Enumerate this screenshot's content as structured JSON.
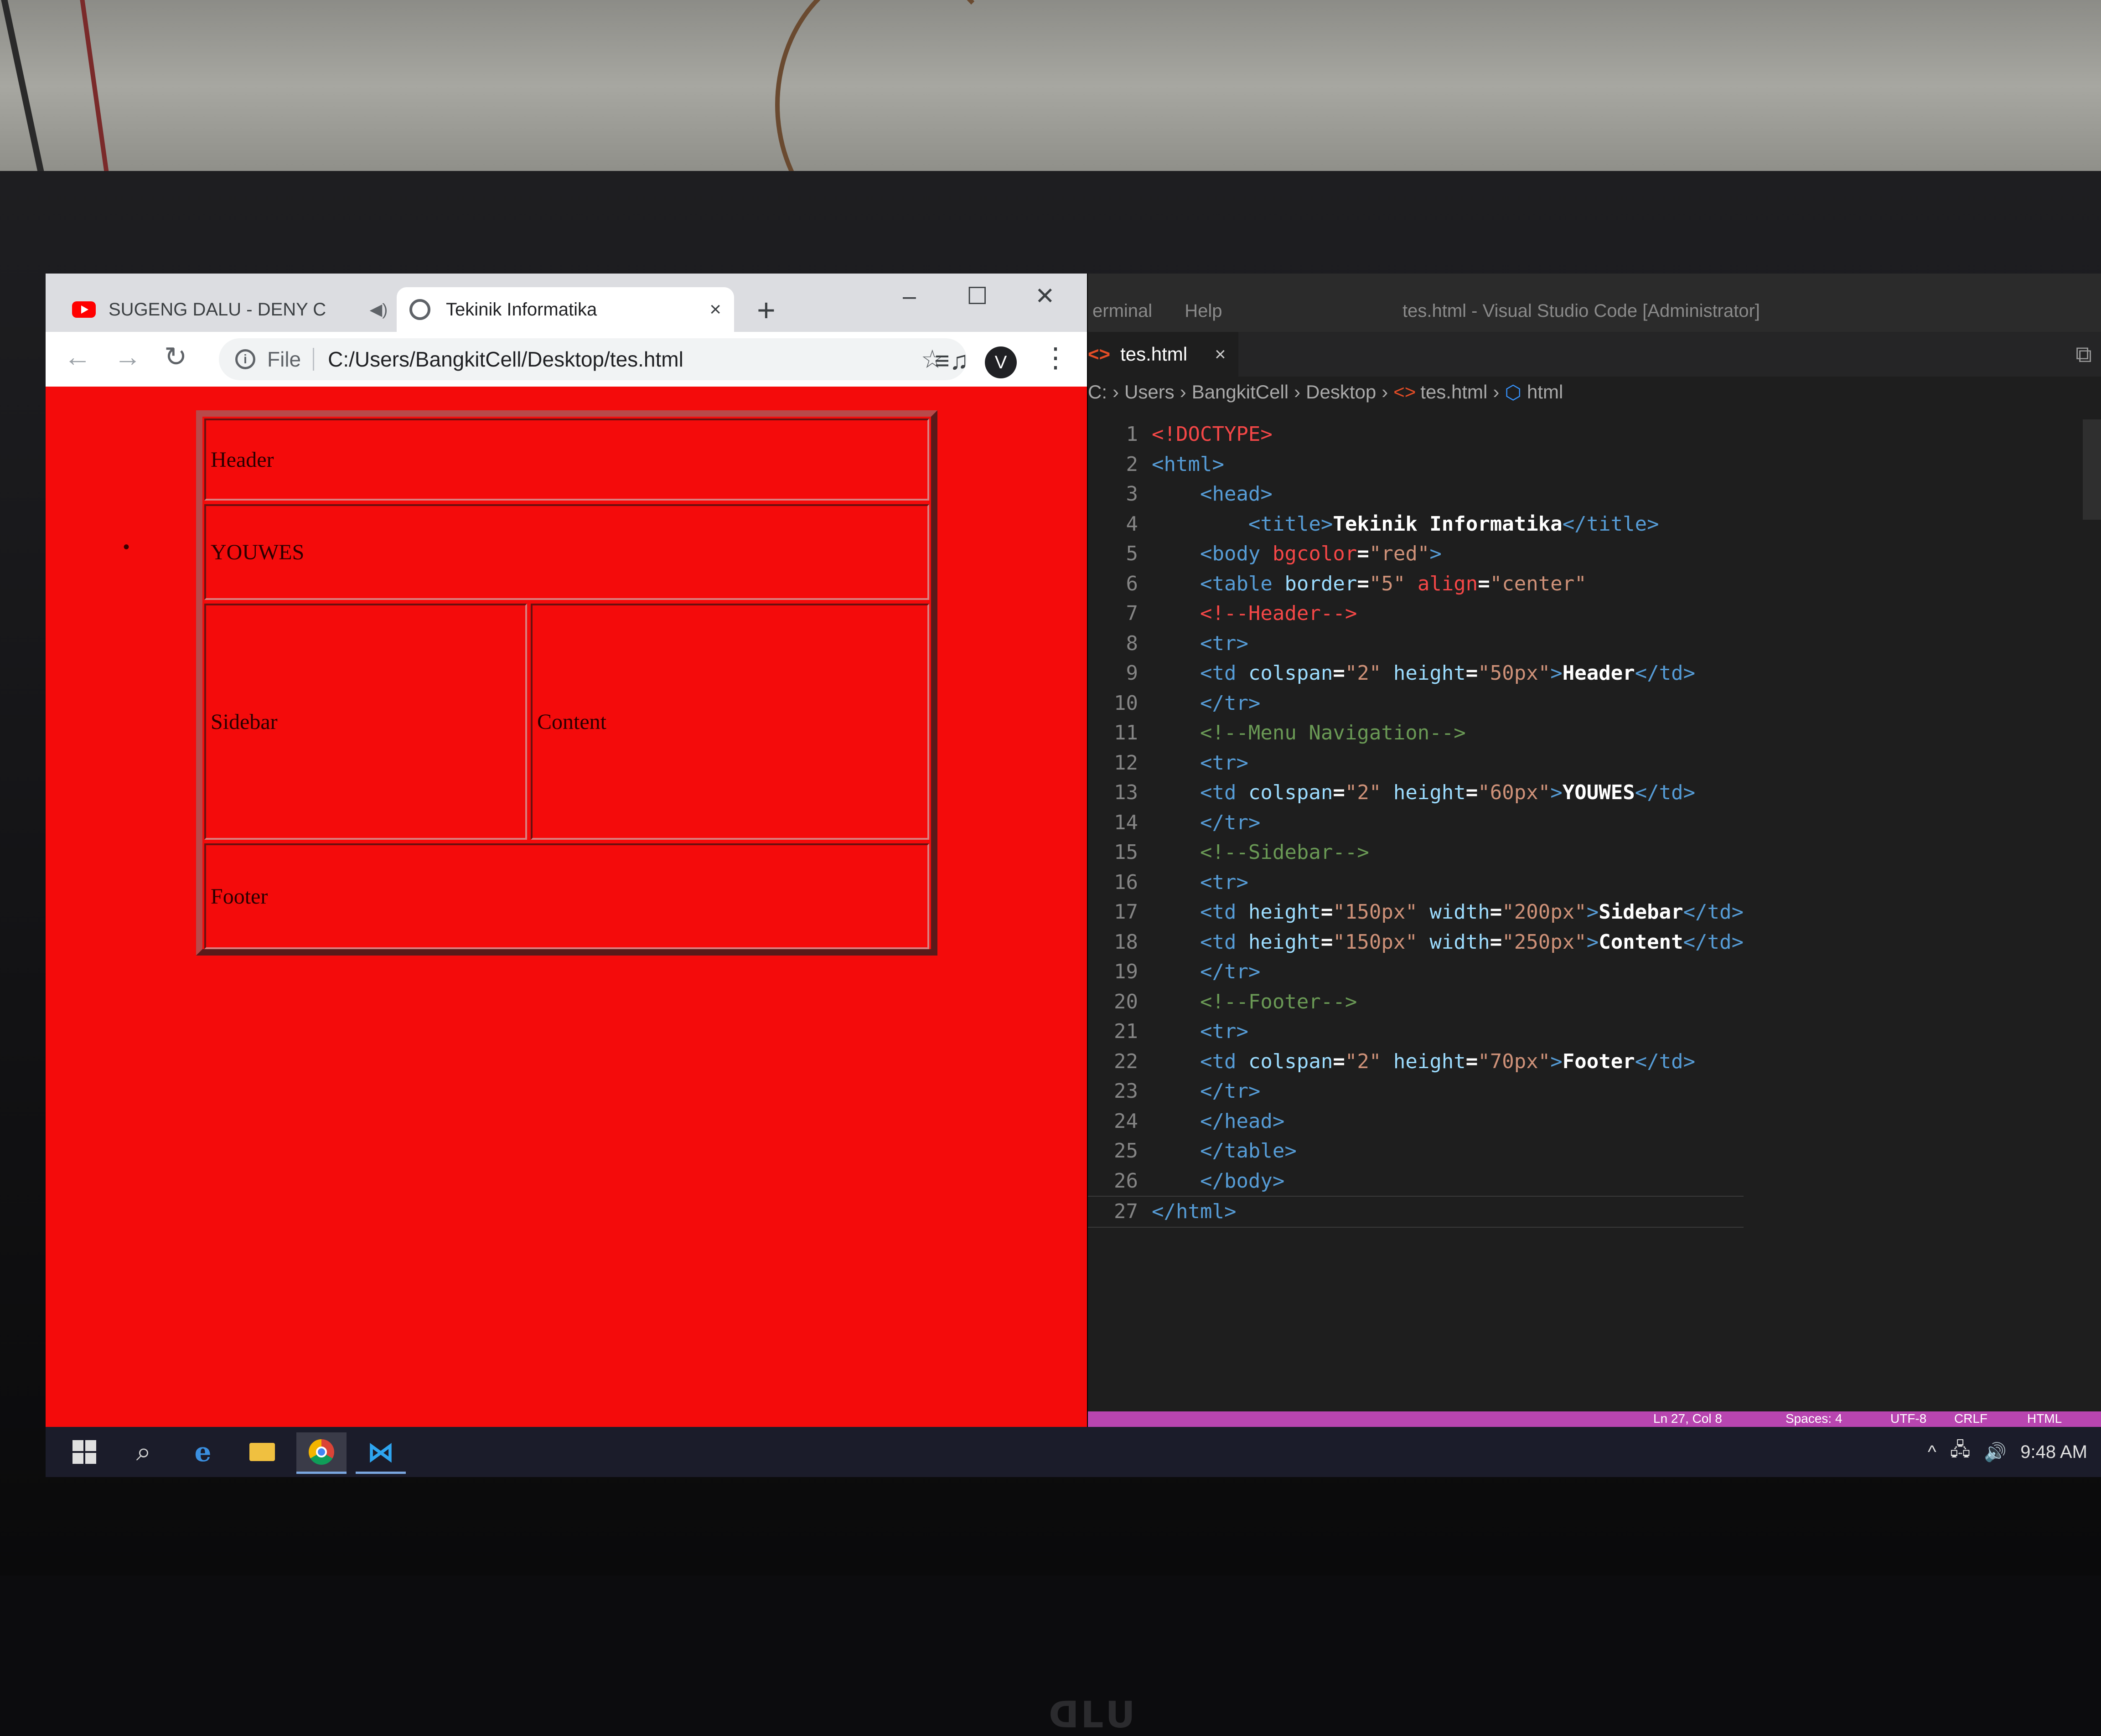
{
  "chrome": {
    "tabs": [
      {
        "title": "SUGENG DALU - DENY C",
        "icon": "youtube-icon",
        "muted_icon": "speaker-icon",
        "close": "×"
      },
      {
        "title": "Tekinik Informatika",
        "icon": "globe-icon",
        "close": "×"
      }
    ],
    "new_tab": "+",
    "window_controls": {
      "minimize": "–",
      "maximize": "☐",
      "close": "✕"
    },
    "nav": {
      "back": "←",
      "forward": "→",
      "reload": "↻"
    },
    "address": {
      "scheme_label": "File",
      "info_icon": "i",
      "url": "C:/Users/BangkitCell/Desktop/tes.html"
    },
    "star": "☆",
    "media": "≡♫",
    "profile_initial": "V",
    "menu": "⋮"
  },
  "page": {
    "bullet": "•",
    "cells": {
      "header": "Header",
      "nav": "YOUWES",
      "sidebar": "Sidebar",
      "content": "Content",
      "footer": "Footer"
    },
    "bgcolor": "#f40b0b"
  },
  "vscode": {
    "menu": [
      "erminal",
      "Help"
    ],
    "window_title": "tes.html - Visual Studio Code [Administrator]",
    "tab": {
      "icon": "<>",
      "name": "tes.html",
      "close": "×"
    },
    "breadcrumb": {
      "drive": "C:",
      "parts": [
        "Users",
        "BangkitCell",
        "Desktop",
        "tes.html",
        "html"
      ]
    },
    "status": {
      "position": "Ln 27, Col 8",
      "spaces": "Spaces: 4",
      "encoding": "UTF-8",
      "eol": "CRLF",
      "lang": "HTML"
    }
  },
  "code_lines": [
    [
      [
        "t-doc",
        "<!DOCTYPE>"
      ]
    ],
    [
      [
        "t-tag",
        "<html>"
      ]
    ],
    [
      [
        "",
        "    "
      ],
      [
        "t-tag",
        "<head>"
      ]
    ],
    [
      [
        "",
        "        "
      ],
      [
        "t-tag",
        "<title>"
      ],
      [
        "t-text",
        "Tekinik Informatika"
      ],
      [
        "t-tag",
        "</title>"
      ]
    ],
    [
      [
        "",
        "    "
      ],
      [
        "t-tag",
        "<body "
      ],
      [
        "t-red",
        "bgcolor"
      ],
      [
        "t-text",
        "="
      ],
      [
        "t-str",
        "\"red\""
      ],
      [
        "t-tag",
        ">"
      ]
    ],
    [
      [
        "",
        "    "
      ],
      [
        "t-tag",
        "<table "
      ],
      [
        "t-attr",
        "border"
      ],
      [
        "t-text",
        "="
      ],
      [
        "t-str",
        "\"5\" "
      ],
      [
        "t-red",
        "align"
      ],
      [
        "t-text",
        "="
      ],
      [
        "t-str",
        "\"center\""
      ]
    ],
    [
      [
        "",
        "    "
      ],
      [
        "t-red",
        "<!--Header-->"
      ]
    ],
    [
      [
        "",
        "    "
      ],
      [
        "t-tag",
        "<tr>"
      ]
    ],
    [
      [
        "",
        "    "
      ],
      [
        "t-tag",
        "<td "
      ],
      [
        "t-attr",
        "colspan"
      ],
      [
        "t-text",
        "="
      ],
      [
        "t-str",
        "\"2\" "
      ],
      [
        "t-attr",
        "height"
      ],
      [
        "t-text",
        "="
      ],
      [
        "t-str",
        "\"50px\""
      ],
      [
        "t-tag",
        ">"
      ],
      [
        "t-text",
        "Header"
      ],
      [
        "t-tag",
        "</td>"
      ]
    ],
    [
      [
        "",
        "    "
      ],
      [
        "t-tag",
        "</tr>"
      ]
    ],
    [
      [
        "",
        "    "
      ],
      [
        "t-com",
        "<!--Menu Navigation-->"
      ]
    ],
    [
      [
        "",
        "    "
      ],
      [
        "t-tag",
        "<tr>"
      ]
    ],
    [
      [
        "",
        "    "
      ],
      [
        "t-tag",
        "<td "
      ],
      [
        "t-attr",
        "colspan"
      ],
      [
        "t-text",
        "="
      ],
      [
        "t-str",
        "\"2\" "
      ],
      [
        "t-attr",
        "height"
      ],
      [
        "t-text",
        "="
      ],
      [
        "t-str",
        "\"60px\""
      ],
      [
        "t-tag",
        ">"
      ],
      [
        "t-text",
        "YOUWES"
      ],
      [
        "t-tag",
        "</td>"
      ]
    ],
    [
      [
        "",
        "    "
      ],
      [
        "t-tag",
        "</tr>"
      ]
    ],
    [
      [
        "",
        "    "
      ],
      [
        "t-com",
        "<!--Sidebar-->"
      ]
    ],
    [
      [
        "",
        "    "
      ],
      [
        "t-tag",
        "<tr>"
      ]
    ],
    [
      [
        "",
        "    "
      ],
      [
        "t-tag",
        "<td "
      ],
      [
        "t-attr",
        "height"
      ],
      [
        "t-text",
        "="
      ],
      [
        "t-str",
        "\"150px\" "
      ],
      [
        "t-attr",
        "width"
      ],
      [
        "t-text",
        "="
      ],
      [
        "t-str",
        "\"200px\""
      ],
      [
        "t-tag",
        ">"
      ],
      [
        "t-text",
        "Sidebar"
      ],
      [
        "t-tag",
        "</td>"
      ]
    ],
    [
      [
        "",
        "    "
      ],
      [
        "t-tag",
        "<td "
      ],
      [
        "t-attr",
        "height"
      ],
      [
        "t-text",
        "="
      ],
      [
        "t-str",
        "\"150px\" "
      ],
      [
        "t-attr",
        "width"
      ],
      [
        "t-text",
        "="
      ],
      [
        "t-str",
        "\"250px\""
      ],
      [
        "t-tag",
        ">"
      ],
      [
        "t-text",
        "Content"
      ],
      [
        "t-tag",
        "</td>"
      ]
    ],
    [
      [
        "",
        "    "
      ],
      [
        "t-tag",
        "</tr>"
      ]
    ],
    [
      [
        "",
        "    "
      ],
      [
        "t-com",
        "<!--Footer-->"
      ]
    ],
    [
      [
        "",
        "    "
      ],
      [
        "t-tag",
        "<tr>"
      ]
    ],
    [
      [
        "",
        "    "
      ],
      [
        "t-tag",
        "<td "
      ],
      [
        "t-attr",
        "colspan"
      ],
      [
        "t-text",
        "="
      ],
      [
        "t-str",
        "\"2\" "
      ],
      [
        "t-attr",
        "height"
      ],
      [
        "t-text",
        "="
      ],
      [
        "t-str",
        "\"70px\""
      ],
      [
        "t-tag",
        ">"
      ],
      [
        "t-text",
        "Footer"
      ],
      [
        "t-tag",
        "</td>"
      ]
    ],
    [
      [
        "",
        "    "
      ],
      [
        "t-tag",
        "</tr>"
      ]
    ],
    [
      [
        "",
        "    "
      ],
      [
        "t-tag",
        "</head>"
      ]
    ],
    [
      [
        "",
        "    "
      ],
      [
        "t-tag",
        "</table>"
      ]
    ],
    [
      [
        "",
        "    "
      ],
      [
        "t-tag",
        "</body>"
      ]
    ],
    [
      [
        "t-tag",
        "</html>"
      ]
    ]
  ],
  "taskbar": {
    "items": [
      "start-icon",
      "search-icon",
      "edge-icon",
      "file-explorer-icon",
      "chrome-icon",
      "vscode-icon"
    ],
    "tray": {
      "chevron": "^",
      "network": "🖧",
      "volume": "🔊",
      "time": "9:48 AM"
    }
  },
  "monitor_brand": "ᗡᒪᑌ"
}
